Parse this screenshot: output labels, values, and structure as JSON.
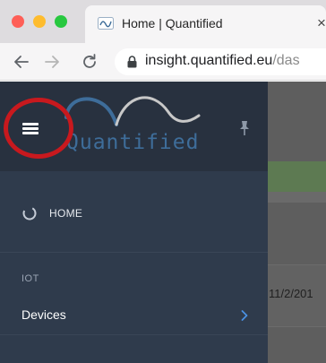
{
  "browser": {
    "tab": {
      "title": "Home | Quantified",
      "close": "×",
      "favicon": "quantified-favicon-icon"
    },
    "nav": {
      "back": "arrow-left-icon",
      "forward": "arrow-right-icon",
      "reload": "reload-icon"
    },
    "address": {
      "host": "insight.quantified.eu",
      "path": "/das",
      "lock": "lock-icon"
    }
  },
  "sidebar": {
    "toggle": "hamburger-menu-icon",
    "logo_text": "Quantified",
    "pin": "pin-icon",
    "home": {
      "label": "HOME",
      "icon": "spinner-circle-icon"
    },
    "section_label": "IOT",
    "devices": {
      "label": "Devices",
      "icon": "chevron-right-icon"
    }
  },
  "content": {
    "date_fragment": "11/2/201"
  },
  "colors": {
    "sidebar_bg": "#2f3b4c",
    "sidebar_header_bg": "#28313f",
    "highlight_ring": "#c8191e",
    "logo_blue": "#3e6d9a",
    "chevron_blue": "#4a90e2",
    "overlay_bg": "#5e5e5e"
  }
}
